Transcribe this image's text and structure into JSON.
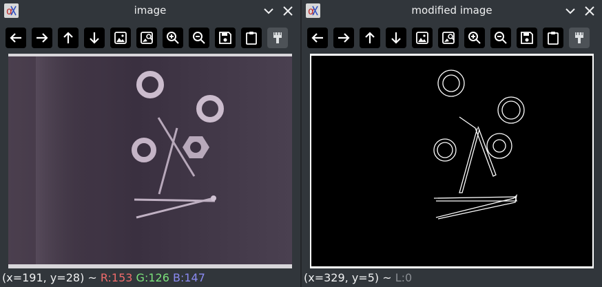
{
  "left_window": {
    "title": "image",
    "status": {
      "coords": "(x=191, y=28) ~",
      "r": "R:153",
      "g": "G:126",
      "b": "B:147"
    }
  },
  "right_window": {
    "title": "modified image",
    "status": {
      "coords": "(x=329, y=5) ~",
      "l": "L:0"
    }
  },
  "toolbar_icons": [
    "arrow-left-icon",
    "arrow-right-icon",
    "arrow-up-icon",
    "arrow-down-icon",
    "image-icon",
    "image-search-icon",
    "zoom-in-icon",
    "zoom-out-icon",
    "save-icon",
    "clipboard-icon",
    "paint-brush-icon"
  ]
}
